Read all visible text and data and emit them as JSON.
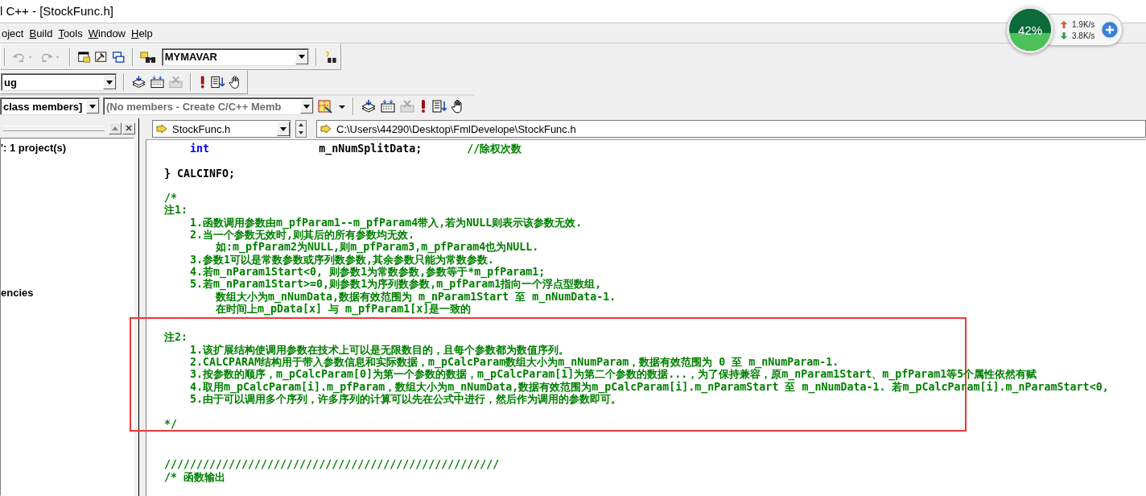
{
  "window": {
    "title": "l C++ - [StockFunc.h]"
  },
  "menu": [
    {
      "label": "oject",
      "underline_first": false
    },
    {
      "label": "Build",
      "underline_first": true
    },
    {
      "label": "Tools",
      "underline_first": true
    },
    {
      "label": "Window",
      "underline_first": true
    },
    {
      "label": "Help",
      "underline_first": true
    }
  ],
  "toolbar_1": {
    "undo_disabled": true,
    "redo_disabled": true,
    "combo": "MYMAVAR"
  },
  "toolbar_2": {
    "combo": "ug"
  },
  "toolbar_3": {
    "class_combo": "class members]",
    "members_combo": "(No members - Create C/C++ Memb"
  },
  "workspace": {
    "items": [
      {
        "label": "': 1 project(s)"
      },
      {
        "label": "encies"
      }
    ]
  },
  "editor": {
    "file_combo": "StockFunc.h",
    "path": "C:\\Users\\44290\\Desktop\\FmlDevelope\\StockFunc.h",
    "blocks": [
      {
        "highlighted": false,
        "lines": [
          {
            "kind": "code",
            "segments": [
              {
                "kind": "keyword",
                "text": "    int"
              },
              {
                "kind": "plain",
                "text": "                 m_nNumSplitData;       "
              },
              {
                "kind": "comment",
                "text": "//除权次数"
              }
            ]
          },
          {
            "kind": "blank"
          },
          {
            "kind": "code",
            "segments": [
              {
                "kind": "plain",
                "text": "} CALCINFO;"
              }
            ]
          },
          {
            "kind": "blank"
          },
          {
            "kind": "code",
            "segments": [
              {
                "kind": "comment",
                "text": "/*"
              }
            ]
          },
          {
            "kind": "code",
            "segments": [
              {
                "kind": "comment",
                "text": "注1:"
              }
            ]
          },
          {
            "kind": "code",
            "segments": [
              {
                "kind": "comment",
                "text": "    1.函数调用参数由m_pfParam1--m_pfParam4带入,若为NULL则表示该参数无效."
              }
            ]
          },
          {
            "kind": "code",
            "segments": [
              {
                "kind": "comment",
                "text": "    2.当一个参数无效时,则其后的所有参数均无效."
              }
            ]
          },
          {
            "kind": "code",
            "segments": [
              {
                "kind": "comment",
                "text": "        如:m_pfParam2为NULL,则m_pfParam3,m_pfParam4也为NULL."
              }
            ]
          },
          {
            "kind": "code",
            "segments": [
              {
                "kind": "comment",
                "text": "    3.参数1可以是常数参数或序列数参数,其余参数只能为常数参数."
              }
            ]
          },
          {
            "kind": "code",
            "segments": [
              {
                "kind": "comment",
                "text": "    4.若m_nParam1Start<0, 则参数1为常数参数,参数等于*m_pfParam1;"
              }
            ]
          },
          {
            "kind": "code",
            "segments": [
              {
                "kind": "comment",
                "text": "    5.若m_nParam1Start>=0,则参数1为序列数参数,m_pfParam1指向一个浮点型数组,"
              }
            ]
          },
          {
            "kind": "code",
            "segments": [
              {
                "kind": "comment",
                "text": "        数组大小为m_nNumData,数据有效范围为 m_nParam1Start 至 m_nNumData-1."
              }
            ]
          },
          {
            "kind": "code",
            "segments": [
              {
                "kind": "comment",
                "text": "        在时间上m_pData[x] 与 m_pfParam1[x]是一致的"
              }
            ]
          }
        ]
      },
      {
        "highlighted": true,
        "lines": [
          {
            "kind": "blank"
          },
          {
            "kind": "code",
            "segments": [
              {
                "kind": "comment",
                "text": "注2:"
              }
            ]
          },
          {
            "kind": "code",
            "segments": [
              {
                "kind": "comment",
                "text": "    1.该扩展结构使调用参数在技术上可以是无限数目的，且每个参数都为数值序列。"
              }
            ]
          },
          {
            "kind": "code",
            "segments": [
              {
                "kind": "comment",
                "text": "    2.CALCPARAM结构用于带入参数信息和实际数据，m_pCalcParam数组大小为m_nNumParam，数据有效范围为 0 至 m_nNumParam-1."
              }
            ]
          },
          {
            "kind": "code",
            "segments": [
              {
                "kind": "comment",
                "text": "    3.按参数的顺序，m_pCalcParam[0]为第一个参数的数据，m_pCalcParam[1]为第二个参数的数据...，为了保持兼容，原m_nParam1Start、m_pfParam1等5个属性依然有赋"
              }
            ]
          },
          {
            "kind": "code",
            "segments": [
              {
                "kind": "comment",
                "text": "    4.取用m_pCalcParam[i].m_pfParam，数组大小为m_nNumData,数据有效范围为m_pCalcParam[i].m_nParamStart 至 m_nNumData-1. 若m_pCalcParam[i].m_nParamStart<0,"
              }
            ]
          },
          {
            "kind": "code",
            "segments": [
              {
                "kind": "comment",
                "text": "    5.由于可以调用多个序列，许多序列的计算可以先在公式中进行，然后作为调用的参数即可。"
              }
            ]
          },
          {
            "kind": "blank"
          },
          {
            "kind": "code",
            "segments": [
              {
                "kind": "comment",
                "text": "*/"
              }
            ]
          }
        ]
      },
      {
        "highlighted": false,
        "lines": [
          {
            "kind": "blank"
          },
          {
            "kind": "blank"
          },
          {
            "kind": "code",
            "segments": [
              {
                "kind": "comment",
                "text": "////////////////////////////////////////////////////"
              }
            ]
          },
          {
            "kind": "code",
            "segments": [
              {
                "kind": "comment",
                "text": "/* 函数输出"
              }
            ]
          }
        ]
      }
    ]
  },
  "net_monitor": {
    "percent": "42%",
    "level": 0.42,
    "upload": "1.9K/s",
    "download": "3.8K/s"
  }
}
